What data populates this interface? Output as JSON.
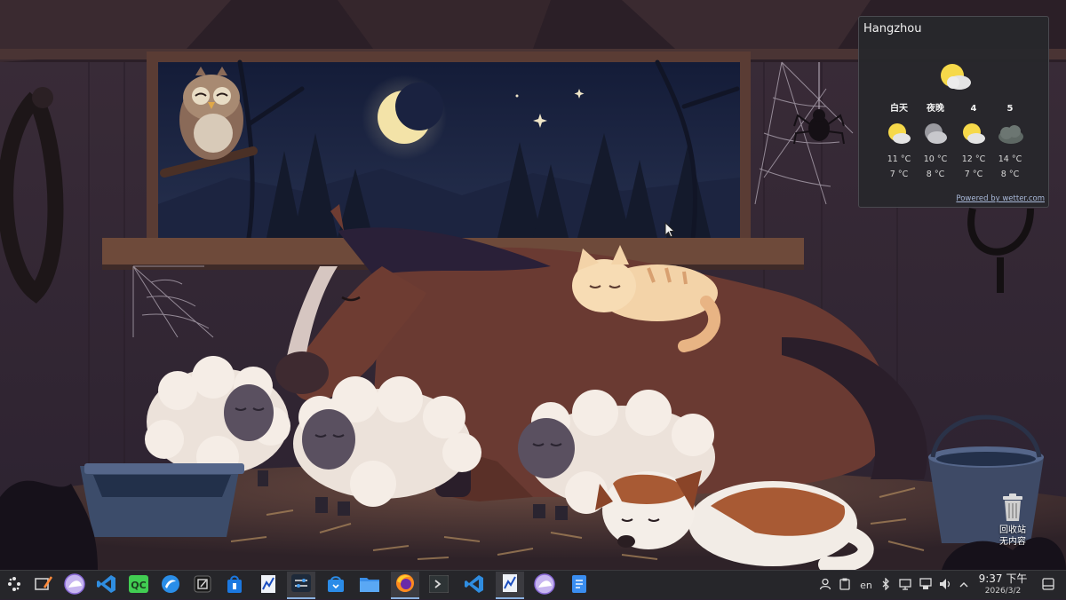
{
  "weather": {
    "city": "Hangzhou",
    "forecast": [
      {
        "label": "白天",
        "icon": "sunny-cloud-icon",
        "high": "11 °C",
        "low": "7 °C"
      },
      {
        "label": "夜晚",
        "icon": "night-cloud-icon",
        "high": "10 °C",
        "low": "8 °C"
      },
      {
        "label": "4",
        "icon": "sunny-cloud-icon",
        "high": "12 °C",
        "low": "7 °C"
      },
      {
        "label": "5",
        "icon": "cloud-icon",
        "high": "14 °C",
        "low": "8 °C"
      }
    ],
    "powered_by": "Powered by wetter.com"
  },
  "trash": {
    "label": "回收站",
    "status": "无内容"
  },
  "tray": {
    "language": "en"
  },
  "clock": {
    "time": "9:37 下午",
    "date": "2026/3/2"
  }
}
